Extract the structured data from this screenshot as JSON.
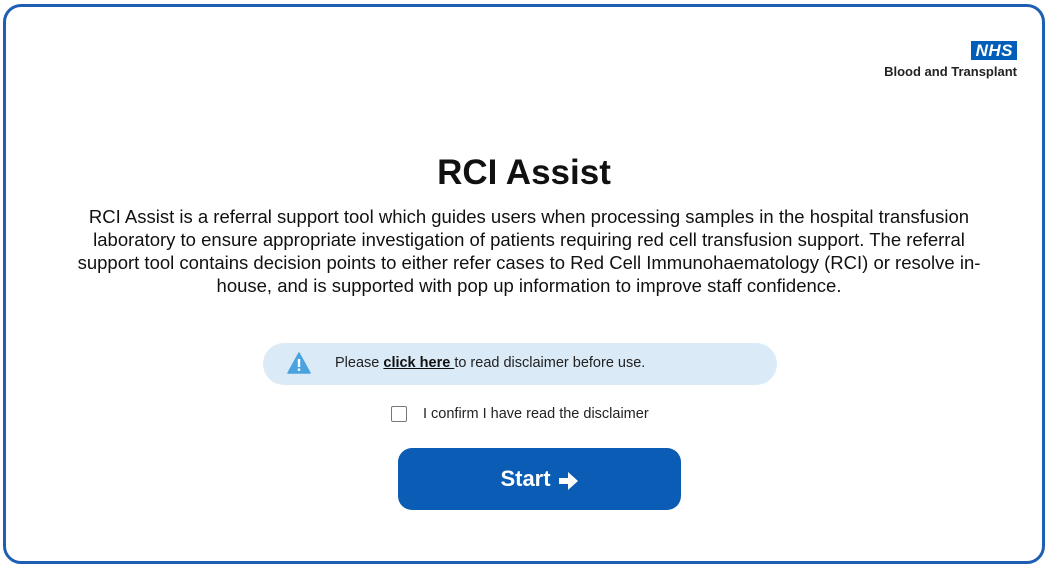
{
  "logo": {
    "badge": "NHS",
    "org_name": "Blood and Transplant"
  },
  "main": {
    "title": "RCI Assist",
    "description": "RCI Assist is a referral support tool which guides users when processing samples in the hospital transfusion laboratory to ensure appropriate investigation of patients requiring red cell transfusion support. The referral support tool contains decision points to either refer cases to Red Cell Immunohaematology (RCI) or resolve in-house, and is supported with pop up information to improve staff confidence."
  },
  "disclaimer": {
    "prefix": "Please ",
    "link_text": "click here ",
    "suffix": "to read disclaimer before use.",
    "icon": "warning-icon"
  },
  "confirm": {
    "label": "I confirm I have read the disclaimer",
    "checked": false
  },
  "start_button": {
    "label": "Start",
    "icon": "arrow-right-icon"
  },
  "colors": {
    "brand_blue": "#005eb8",
    "button_blue": "#0b5cb4",
    "frame_blue": "#1e5fb3",
    "pill_bg": "#daeaf6",
    "warning_blue": "#4aa3df"
  }
}
